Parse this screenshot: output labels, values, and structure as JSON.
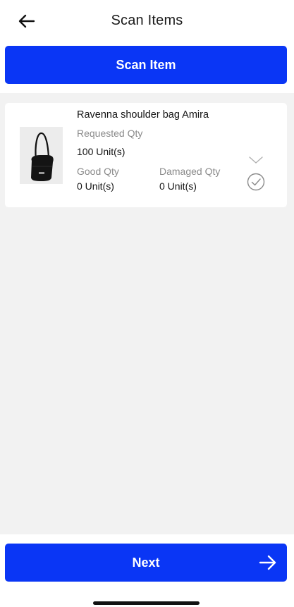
{
  "header": {
    "title": "Scan Items",
    "back_icon": "arrow-left-icon"
  },
  "actions": {
    "scan_label": "Scan Item",
    "next_label": "Next",
    "next_icon": "arrow-right-icon"
  },
  "items": [
    {
      "name": "Ravenna shoulder bag Amira",
      "requested_label": "Requested Qty",
      "requested_value": "100 Unit(s)",
      "good_label": "Good Qty",
      "good_value": "0 Unit(s)",
      "damaged_label": "Damaged Qty",
      "damaged_value": "0 Unit(s)",
      "expand_icon": "chevron-down-icon",
      "status_icon": "check-circle-icon"
    }
  ],
  "colors": {
    "accent": "#0a36f5",
    "background": "#f2f2f2",
    "card": "#ffffff",
    "muted_text": "#8a8a8a"
  }
}
